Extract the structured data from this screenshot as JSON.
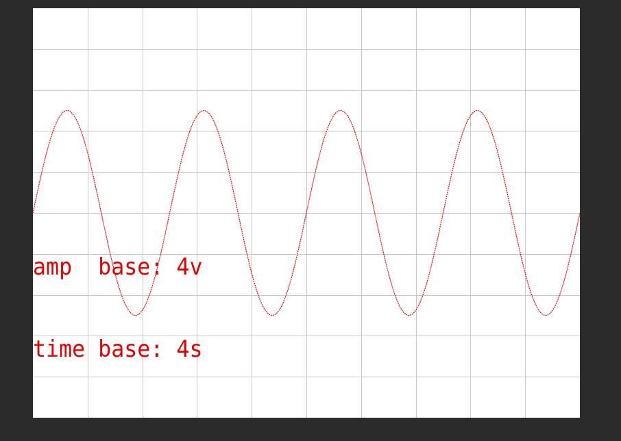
{
  "chart_data": {
    "type": "line",
    "title": "",
    "xlabel": "",
    "ylabel": "",
    "grid": true,
    "divisions": {
      "x": 10,
      "y": 10
    },
    "xlim": [
      0,
      10
    ],
    "ylim": [
      -5,
      5
    ],
    "series": [
      {
        "color": "#e60000",
        "waveform": "sine",
        "amplitude_div": 2.5,
        "period_div": 2.5,
        "phase_div": 0,
        "points": [
          {
            "x": 0,
            "y": 0
          },
          {
            "x": 0.625,
            "y": 2.5
          },
          {
            "x": 1.25,
            "y": 0
          },
          {
            "x": 1.875,
            "y": -2.5
          },
          {
            "x": 2.5,
            "y": 0
          },
          {
            "x": 3.125,
            "y": 2.5
          },
          {
            "x": 3.75,
            "y": 0
          },
          {
            "x": 4.375,
            "y": -2.5
          },
          {
            "x": 5,
            "y": 0
          },
          {
            "x": 5.625,
            "y": 2.5
          },
          {
            "x": 6.25,
            "y": 0
          },
          {
            "x": 6.875,
            "y": -2.5
          },
          {
            "x": 7.5,
            "y": 0
          },
          {
            "x": 8.125,
            "y": 2.5
          },
          {
            "x": 8.75,
            "y": 0
          },
          {
            "x": 9.375,
            "y": -2.5
          },
          {
            "x": 10,
            "y": 0
          }
        ]
      }
    ]
  },
  "readout": {
    "amp_line": "amp  base: 4v",
    "time_line": "time base: 4s"
  },
  "colors": {
    "background": "#2b2b2b",
    "screen": "#ffffff",
    "grid": "#c8c8c8",
    "trace": "#e60000",
    "text": "#e60000"
  }
}
